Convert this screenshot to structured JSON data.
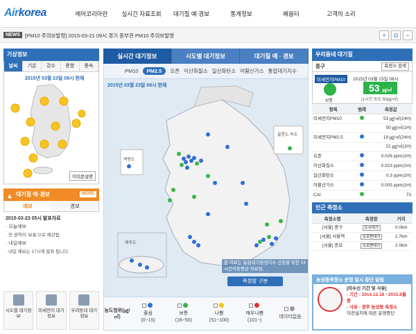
{
  "header": {
    "logo_a": "Air",
    "logo_b": "korea",
    "nav": [
      "에어코리아란",
      "실시간 자료조회",
      "대기질 예·경보",
      "통계정보",
      "배움터",
      "고객의 소리"
    ]
  },
  "news": {
    "label": "NEWS",
    "text": "[PM10 주의보발령] 2015-03-21 09시 경기 중부권 PM10 주의보발령",
    "btns": [
      "+",
      "⊙",
      "−"
    ]
  },
  "weather": {
    "title": "기상정보",
    "tabs": [
      "날씨",
      "기온",
      "강수",
      "풍향",
      "풍속"
    ],
    "date": "2015년 03월 23일 08시 현재",
    "more": "이미콘설명"
  },
  "forecast": {
    "title": "대기질 예·경보",
    "more": "MORE",
    "tabs": [
      "예보",
      "경보"
    ],
    "date": "2015-03-23 05시 발표자료",
    "today": "· 오늘예보",
    "today_text": "· 전 권역이 '보통'으로 예상됨.",
    "tomorrow": "· 내일예보",
    "tomorrow_text": "· 내일 예보는 17시에 발표 됩니다."
  },
  "quick": [
    {
      "label": "시도별 대기정보"
    },
    {
      "label": "미세먼지 대기정보"
    },
    {
      "label": "우리동네 대기정보"
    }
  ],
  "center": {
    "tabs": [
      "실시간 대기정보",
      "시도별 대기정보",
      "대기질 예 · 경보"
    ],
    "subtabs": [
      "PM10",
      "PM2.5",
      "오존",
      "이산화질소",
      "일산화탄소",
      "아황산가스",
      "통합대기지수"
    ],
    "date": "2015년 03월 23일 08시 현재",
    "note": "본 자료는 통합대기환경지수 산정을 위한 24시간이동평균 자료임.",
    "btn": "측정망 구분",
    "labels": {
      "baengnyeong": "백령도",
      "jeju": "제주도",
      "ulleung": "울릉도·독도"
    }
  },
  "legend": {
    "title": "농도범위(㎍/㎥)",
    "items": [
      {
        "name": "좋음",
        "range": "(0~15)",
        "color": "#2f6fd6"
      },
      {
        "name": "보통",
        "range": "(16~50)",
        "color": "#39b54a"
      },
      {
        "name": "나쁨",
        "range": "(51~100)",
        "color": "#f0c419"
      },
      {
        "name": "매우나쁨",
        "range": "(101~)",
        "color": "#e0342b"
      },
      {
        "name": "데이터없음",
        "range": "",
        "color": "#999999"
      }
    ]
  },
  "right": {
    "title": "우리동네 대기질",
    "location": "중구",
    "search": "측정소 검색",
    "pm_label": "미세먼지PM10",
    "date": "2015년 03월 23일 08시",
    "value": "53",
    "unit": "㎍/㎥",
    "avg": "(1시간 농도:50㎍/㎥)",
    "status": "보통",
    "cols": [
      "항목",
      "범례",
      "측정값"
    ],
    "rows": [
      {
        "name": "미세먼지PM10",
        "val": "53 ㎍/㎥(24H)",
        "color": "#39b54a"
      },
      {
        "name": "",
        "val": "50 ㎍/㎥(1H)",
        "color": ""
      },
      {
        "name": "미세먼지PM2.5",
        "val": "19 ㎍/㎥(24H)",
        "color": "#2f6fd6"
      },
      {
        "name": "",
        "val": "21 ㎍/㎥(1H)",
        "color": ""
      },
      {
        "name": "오존",
        "val": "0.026 ppm(1H)",
        "color": "#2f6fd6"
      },
      {
        "name": "이산화질소",
        "val": "0.023 ppm(1H)",
        "color": "#2f6fd6"
      },
      {
        "name": "일산화탄소",
        "val": "0.3 ppm(1H)",
        "color": "#2f6fd6"
      },
      {
        "name": "아황산가스",
        "val": "0.005 ppm(1H)",
        "color": "#2f6fd6"
      },
      {
        "name": "CAI",
        "val": "73",
        "color": "#39b54a"
      }
    ],
    "near_title": "인근 측정소",
    "near_cols": [
      "측정소명",
      "측정망",
      "거리"
    ],
    "near": [
      {
        "name": "[서울] 중구",
        "net": "도시대기",
        "dist": "0.0km"
      },
      {
        "name": "[서울] 서울역",
        "net": "도로변대기",
        "dist": "1.7km"
      },
      {
        "name": "[서울] 종로",
        "net": "도로변대기",
        "dist": "2.0km"
      }
    ]
  },
  "notice": {
    "title": "농성동측정소 운영 일시 중단 알림",
    "line1": "[미수신 기간 및 사유]",
    "line2": "- 기간 : 2014.12.18 ~2015.8월 중",
    "line3": "- 사유 : 광주 농성동 측정소",
    "line4": "이전설치에 따른 운영중단"
  }
}
